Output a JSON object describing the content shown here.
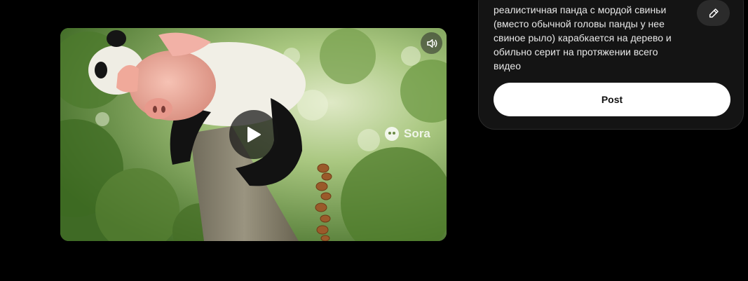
{
  "video": {
    "watermark": "Sora",
    "icons": {
      "mute": "speaker-icon",
      "play": "play-icon",
      "watermark": "sora-logo-icon"
    }
  },
  "panel": {
    "prompt": "реалистичная панда с мордой свиньи (вместо обычной головы панды у нее свиное рыло) карабкается на дерево и обильно серит на протяжении всего видео",
    "edit_icon": "pencil-icon",
    "post_label": "Post"
  },
  "colors": {
    "background": "#000000",
    "panel": "#141414",
    "post_button": "#ffffff",
    "edit_button": "#2b2b2b"
  }
}
